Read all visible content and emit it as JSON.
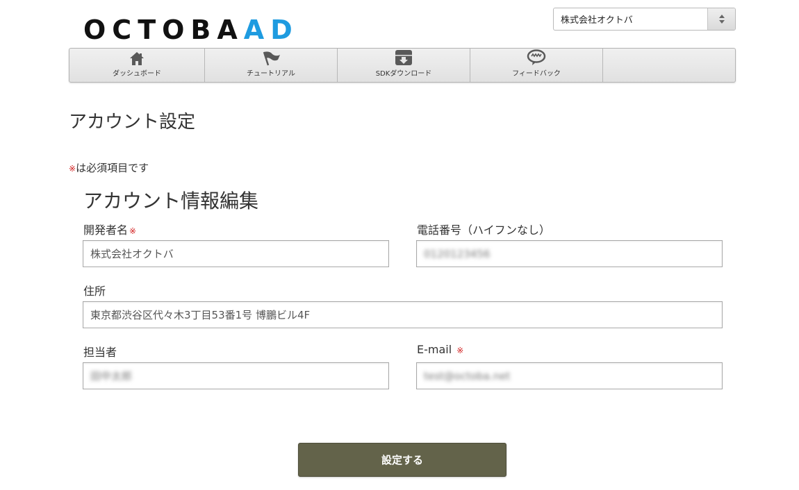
{
  "logo": {
    "main": "OCTOBA",
    "accent": "AD"
  },
  "account_selector": {
    "value": "株式会社オクトバ"
  },
  "nav": {
    "items": [
      {
        "label": "ダッシュボード",
        "icon": "home-icon"
      },
      {
        "label": "チュートリアル",
        "icon": "flag-icon"
      },
      {
        "label": "SDKダウンロード",
        "icon": "download-box-icon"
      },
      {
        "label": "フィードバック",
        "icon": "speech-bubble-icon"
      },
      {
        "label": "",
        "icon": ""
      }
    ]
  },
  "page": {
    "title": "アカウント設定",
    "required_mark": "※",
    "required_note": "は必須項目です",
    "section_title": "アカウント情報編集"
  },
  "form": {
    "developer_name": {
      "label": "開発者名",
      "value": "株式会社オクトバ",
      "required": true
    },
    "phone": {
      "label": "電話番号（ハイフンなし）",
      "value": "0120123456"
    },
    "address": {
      "label": "住所",
      "value": "東京都渋谷区代々木3丁目53番1号 博鵬ビル4F"
    },
    "contact_person": {
      "label": "担当者",
      "value": "田中太郎"
    },
    "email": {
      "label": "E-mail",
      "value": "test@octoba.net",
      "required": true
    }
  },
  "submit": {
    "label": "設定する"
  },
  "colors": {
    "accent": "#1e9be0",
    "required": "#d21f1f",
    "button": "#63634a"
  }
}
